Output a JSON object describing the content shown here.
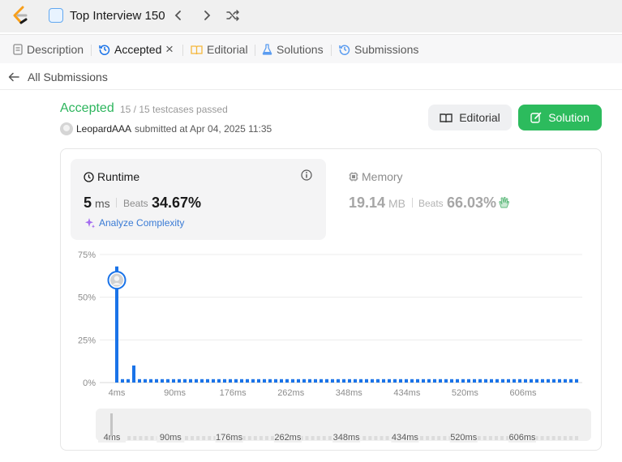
{
  "topbar": {
    "title": "Top Interview 150",
    "icons": [
      "leetcode-logo",
      "chevron-left-icon",
      "chevron-right-icon",
      "shuffle-icon"
    ]
  },
  "tabs": [
    {
      "label": "Description",
      "icon": "description-icon"
    },
    {
      "label": "Accepted",
      "icon": "history-icon",
      "active": true
    },
    {
      "label": "Editorial",
      "icon": "book-icon"
    },
    {
      "label": "Solutions",
      "icon": "flask-icon"
    },
    {
      "label": "Submissions",
      "icon": "history-icon"
    }
  ],
  "back": {
    "label": "All Submissions"
  },
  "result": {
    "status": "Accepted",
    "testcases": "15 / 15 testcases passed",
    "username": "LeopardAAA",
    "submitted": "submitted at Apr 04, 2025 11:35"
  },
  "buttons": {
    "editorial": "Editorial",
    "solution": "Solution"
  },
  "runtime": {
    "title": "Runtime",
    "value": "5",
    "unit": "ms",
    "beats_label": "Beats",
    "beats": "34.67%",
    "analyze": "Analyze Complexity"
  },
  "memory": {
    "title": "Memory",
    "value": "19.14",
    "unit": "MB",
    "beats_label": "Beats",
    "beats": "66.03%"
  },
  "colors": {
    "accepted": "#2db55d",
    "bar": "#1a73e8",
    "solution_btn": "#2cbb5d",
    "link": "#3a7bd5"
  },
  "chart_data": {
    "type": "bar",
    "title": "",
    "xlabel": "",
    "ylabel": "",
    "ylim": [
      0,
      75
    ],
    "yticks": [
      "75%",
      "50%",
      "25%",
      "0%"
    ],
    "xticks": [
      "4ms",
      "90ms",
      "176ms",
      "262ms",
      "348ms",
      "434ms",
      "520ms",
      "606ms"
    ],
    "navigator_ticks": [
      "4ms",
      "90ms",
      "176ms",
      "262ms",
      "348ms",
      "434ms",
      "520ms",
      "606ms"
    ],
    "values": [
      68,
      2,
      2,
      10,
      2,
      2,
      2,
      2,
      2,
      2,
      2,
      2,
      2,
      2,
      2,
      2,
      2,
      2,
      2,
      2,
      2,
      2,
      2,
      2,
      2,
      2,
      2,
      2,
      2,
      2,
      2,
      2,
      2,
      2,
      2,
      2,
      2,
      2,
      2,
      2,
      2,
      2,
      2,
      2,
      2,
      2,
      2,
      2,
      2,
      2,
      2,
      2,
      2,
      2,
      2,
      2,
      2,
      2,
      2,
      2,
      2,
      2,
      2,
      2,
      2,
      2,
      2,
      2,
      2,
      2,
      2,
      2,
      2,
      2,
      2,
      2,
      2,
      2,
      2,
      2,
      2,
      2
    ],
    "highlight_index": 0,
    "highlight_value": 60,
    "grid": true
  }
}
